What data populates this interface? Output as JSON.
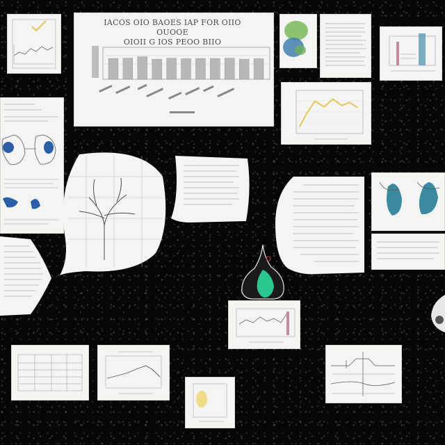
{
  "scene": {
    "background_color": "#070707",
    "paper_color": "#f4f4f2",
    "accent_colors": [
      "#e8c55a",
      "#3f7fb0",
      "#2cc78e",
      "#5a9bb5"
    ]
  },
  "main_poster": {
    "heading_lines": [
      "IACOS OIO BAOES IAP FOR OIIO OUOOE",
      "OIOII G IOS PEOO BIIO"
    ],
    "bar_values": [
      0.85,
      0.86,
      0.92,
      0.82,
      0.86,
      0.84,
      0.85,
      0.85,
      0.86,
      0.82,
      0.84
    ]
  },
  "line_chart": {
    "points": [
      [
        0.05,
        0.85
      ],
      [
        0.15,
        0.55
      ],
      [
        0.28,
        0.25
      ],
      [
        0.42,
        0.38
      ],
      [
        0.55,
        0.2
      ],
      [
        0.68,
        0.35
      ],
      [
        0.8,
        0.28
      ],
      [
        0.92,
        0.4
      ]
    ]
  }
}
